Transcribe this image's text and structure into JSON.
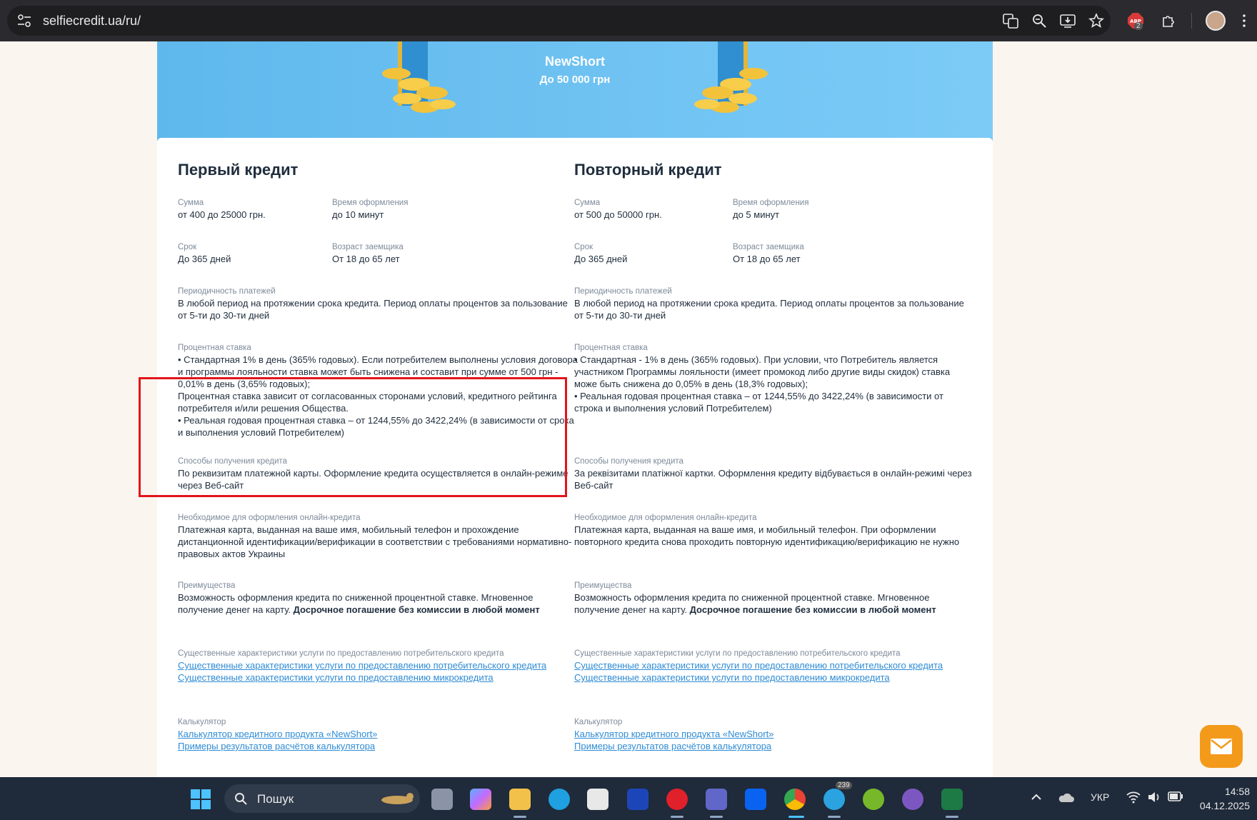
{
  "browser": {
    "url": "selfiecredit.ua/ru/",
    "badge_count": "2"
  },
  "hero": {
    "product": "NewShort",
    "subtitle": "До 50 000 грн"
  },
  "left": {
    "title": "Первый кредит",
    "sum_label": "Сумма",
    "sum_value": "от 400 до 25000 грн.",
    "time_label": "Время оформления",
    "time_value": "до 10 минут",
    "term_label": "Срок",
    "term_value": "До 365 дней",
    "age_label": "Возраст заемщика",
    "age_value": "От 18 до 65 лет",
    "period_label": "Периодичность платежей",
    "period_value": "В любой период на протяжении срока кредита. Период оплаты процентов за пользование от 5-ти до 30-ти дней",
    "rate_label": "Процентная ставка",
    "rate_value_1": "• Стандартная 1% в день (365% годовых). Если потребителем выполнены условия договора и программы лояльности ставка может быть снижена и составит при сумме от 500 грн - 0,01% в день (3,65% годовых);",
    "rate_value_2": "Процентная ставка зависит от согласованных сторонами условий, кредитного рейтинга потребителя и/или решения Общества.",
    "rate_value_3": "• Реальная годовая процентная ставка – от 1244,55% до 3422,24% (в зависимости от срока и выполнения условий Потребителем)",
    "methods_label": "Способы получения кредита",
    "methods_value": "По реквизитам платежной карты. Оформление кредита осуществляется в онлайн-режиме через Веб-сайт",
    "required_label": "Необходимое для оформления онлайн-кредита",
    "required_value": "Платежная карта, выданная на ваше имя, мобильный телефон и прохождение дистанционной идентификации/верификации в соответствии с требованиями нормативно-правовых актов Украины",
    "adv_label": "Преимущества",
    "adv_value": "Возможность оформления кредита по сниженной процентной ставке. Мгновенное получение денег на карту.",
    "adv_bold": "Досрочное погашение без комиссии в любой момент",
    "chars_label": "Существенные характеристики услуги по предоставлению потребительского кредита",
    "chars_link_1": "Существенные характеристики услуги по предоставлению потребительского кредита",
    "chars_link_2": "Существенные характеристики услуги по предоставлению микрокредита",
    "calc_label": "Калькулятор",
    "calc_link_1": "Калькулятор кредитного продукта «NewShort»",
    "calc_link_2": "Примеры результатов расчётов калькулятора"
  },
  "right": {
    "title": "Повторный кредит",
    "sum_label": "Сумма",
    "sum_value": "от 500 до 50000 грн.",
    "time_label": "Время оформления",
    "time_value": "до 5 минут",
    "term_label": "Срок",
    "term_value": "До 365 дней",
    "age_label": "Возраст заемщика",
    "age_value": "От 18 до 65 лет",
    "period_label": "Периодичность платежей",
    "period_value": "В любой период на протяжении срока кредита. Период оплаты процентов за пользование от 5-ти до 30-ти дней",
    "rate_label": "Процентная ставка",
    "rate_value_1": "• Стандартная - 1% в день (365% годовых). При условии, что Потребитель является участником Программы лояльности (имеет промокод либо другие виды скидок) ставка може быть снижена до 0,05% в день (18,3% годовых);",
    "rate_value_2": "• Реальная годовая процентная ставка – от 1244,55% до 3422,24% (в зависимости от строка и выполнения условий Потребителем)",
    "methods_label": "Способы получения кредита",
    "methods_value": "За реквізитами платіжної картки. Оформлення кредиту відбувається в онлайн-режимі через Веб-сайт",
    "required_label": "Необходимое для оформления онлайн-кредита",
    "required_value": "Платежная карта, выданная на ваше имя, и мобильный телефон. При оформлении повторного кредита снова проходить повторную идентификацию/верификацию не нужно",
    "adv_label": "Преимущества",
    "adv_value": "Возможность оформления кредита по сниженной процентной ставке. Мгновенное получение денег на карту.",
    "adv_bold": "Досрочное погашение без комиссии в любой момент",
    "chars_label": "Существенные характеристики услуги по предоставлению потребительского кредита",
    "chars_link_1": "Существенные характеристики услуги по предоставлению потребительского кредита",
    "chars_link_2": "Существенные характеристики услуги по предоставлению микрокредита",
    "calc_label": "Калькулятор",
    "calc_link_1": "Калькулятор кредитного продукта «NewShort»",
    "calc_link_2": "Примеры результатов расчётов калькулятора"
  },
  "taskbar": {
    "search_placeholder": "Пошук",
    "telegram_badge": "239",
    "language": "УКР",
    "time": "14:58",
    "date": "04.12.2025"
  },
  "colors": {
    "accent": "#2e8bd4",
    "highlight": "#e3141b",
    "hero": "#6cc1f2",
    "chat": "#f39a1b"
  }
}
